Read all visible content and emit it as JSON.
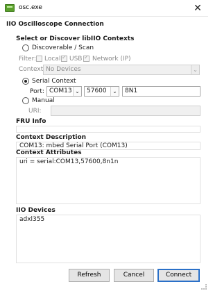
{
  "window": {
    "title": "osc.exe",
    "close_glyph": "✕"
  },
  "dialog": {
    "title": "IIO Oscilloscope Connection"
  },
  "discover": {
    "group_title": "Select or Discover libIIO Contexts",
    "scan_radio_label": "Discoverable / Scan",
    "filter_label": "Filter:",
    "filter_local": "Local",
    "filter_usb": "USB",
    "filter_network": "Network (IP)",
    "context_label": "Context:",
    "context_value": "No Devices"
  },
  "serial": {
    "radio_label": "Serial Context",
    "port_label": "Port:",
    "port_value": "COM13",
    "baud_value": "57600",
    "config_value": "8N1"
  },
  "manual": {
    "radio_label": "Manual",
    "uri_label": "URI:",
    "uri_value": ""
  },
  "fru": {
    "title": "FRU Info",
    "value": ""
  },
  "context_description": {
    "title": "Context Description",
    "value": "COM13: mbed Serial Port (COM13)"
  },
  "context_attributes": {
    "title": "Context Attributes",
    "value": "uri = serial:COM13,57600,8n1n"
  },
  "iio_devices": {
    "title": "IIO Devices",
    "value": "adxl355"
  },
  "buttons": {
    "refresh": "Refresh",
    "cancel": "Cancel",
    "connect": "Connect"
  },
  "icons": {
    "checkmark": "✓",
    "dropdown": "⌄"
  },
  "selection": {
    "mode": "serial",
    "local_checked": false,
    "usb_checked": true,
    "network_checked": true
  }
}
